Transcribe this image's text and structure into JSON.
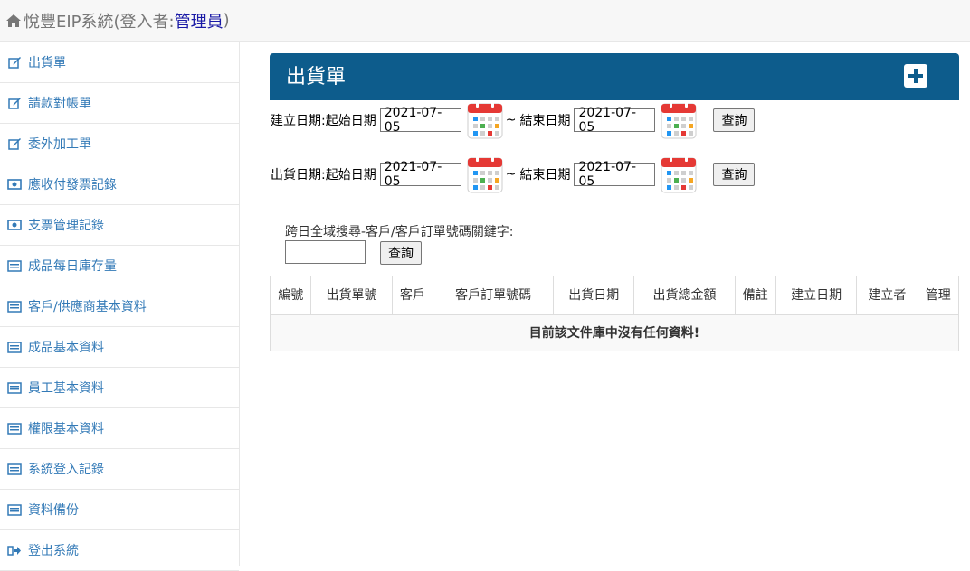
{
  "header": {
    "title_prefix": "悅豐EIP系統(登入者:",
    "user": "管理員",
    "title_suffix": ")"
  },
  "sidebar": {
    "items": [
      {
        "label": "出貨單",
        "icon": "edit-icon"
      },
      {
        "label": "請款對帳單",
        "icon": "edit-icon"
      },
      {
        "label": "委外加工單",
        "icon": "edit-icon"
      },
      {
        "label": "應收付發票記錄",
        "icon": "money-icon"
      },
      {
        "label": "支票管理記錄",
        "icon": "money-icon"
      },
      {
        "label": "成品每日庫存量",
        "icon": "list-icon"
      },
      {
        "label": "客戶/供應商基本資料",
        "icon": "list-icon"
      },
      {
        "label": "成品基本資料",
        "icon": "list-icon"
      },
      {
        "label": "員工基本資料",
        "icon": "list-icon"
      },
      {
        "label": "權限基本資料",
        "icon": "list-icon"
      },
      {
        "label": "系統登入記錄",
        "icon": "list-icon"
      },
      {
        "label": "資料備份",
        "icon": "list-icon"
      },
      {
        "label": "登出系統",
        "icon": "logout-icon"
      }
    ]
  },
  "panel": {
    "title": "出貨單",
    "add_icon": "plus-square-icon",
    "header_color": "#0d5c8c"
  },
  "filters": {
    "create": {
      "label": "建立日期:起始日期",
      "start": "2021-07-05",
      "tilde": "~",
      "end_label": "結束日期",
      "end": "2021-07-05",
      "button": "查詢"
    },
    "ship": {
      "label": "出貨日期:起始日期",
      "start": "2021-07-05",
      "tilde": "~",
      "end_label": "結束日期",
      "end": "2021-07-05",
      "button": "查詢"
    }
  },
  "global_search": {
    "label": "跨日全域搜尋-客戶/客戶訂單號碼關鍵字:",
    "value": "",
    "button": "查詢"
  },
  "table": {
    "headers": [
      "編號",
      "出貨單號",
      "客戶",
      "客戶訂單號碼",
      "出貨日期",
      "出貨總金額",
      "備註",
      "建立日期",
      "建立者",
      "管理"
    ],
    "empty_message": "目前該文件庫中沒有任何資料!"
  }
}
